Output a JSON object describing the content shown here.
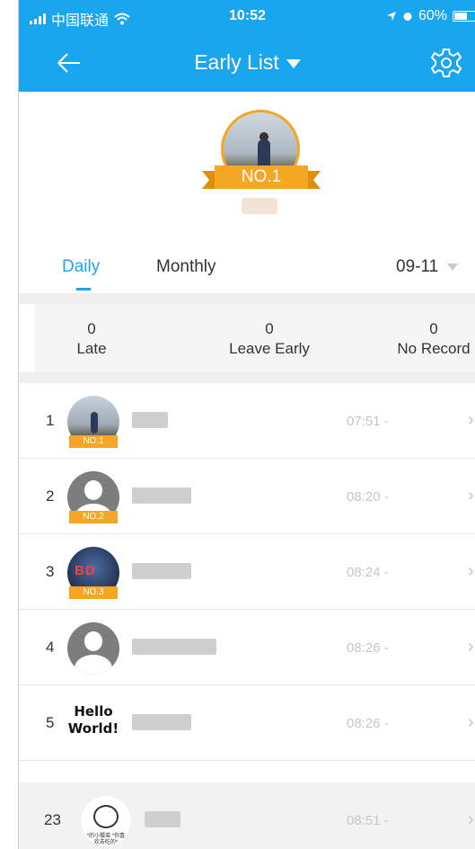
{
  "status_bar": {
    "carrier": "中国联通",
    "time": "10:52",
    "battery": "60%"
  },
  "nav": {
    "title": "Early List"
  },
  "champion": {
    "badge": "NO.1"
  },
  "tabs": [
    {
      "label": "Daily",
      "active": true
    },
    {
      "label": "Monthly",
      "active": false
    }
  ],
  "date_select": {
    "value": "09-11"
  },
  "stats": [
    {
      "value": "0",
      "label": "Late"
    },
    {
      "value": "0",
      "label": "Leave Early"
    },
    {
      "value": "0",
      "label": "No Record"
    }
  ],
  "list": [
    {
      "rank": "1",
      "time": "07:51 -",
      "badge": "NO.1",
      "avatar": "photo"
    },
    {
      "rank": "2",
      "time": "08:20 -",
      "badge": "NO.2",
      "avatar": "default"
    },
    {
      "rank": "3",
      "time": "08:24 -",
      "badge": "NO.3",
      "avatar": "bdf"
    },
    {
      "rank": "4",
      "time": "08:26 -",
      "badge": "",
      "avatar": "default"
    },
    {
      "rank": "5",
      "time": "08:26 -",
      "badge": "",
      "avatar": "hello",
      "avatar_text": "Hello World!"
    },
    {
      "rank": "23",
      "time": "08:51 -",
      "badge": "",
      "avatar": "cartoon",
      "avatar_caption": "*的小樱菜\n*你喜欢去吃的*"
    }
  ],
  "colors": {
    "accent": "#1aa6ef",
    "gold": "#f5a623"
  }
}
